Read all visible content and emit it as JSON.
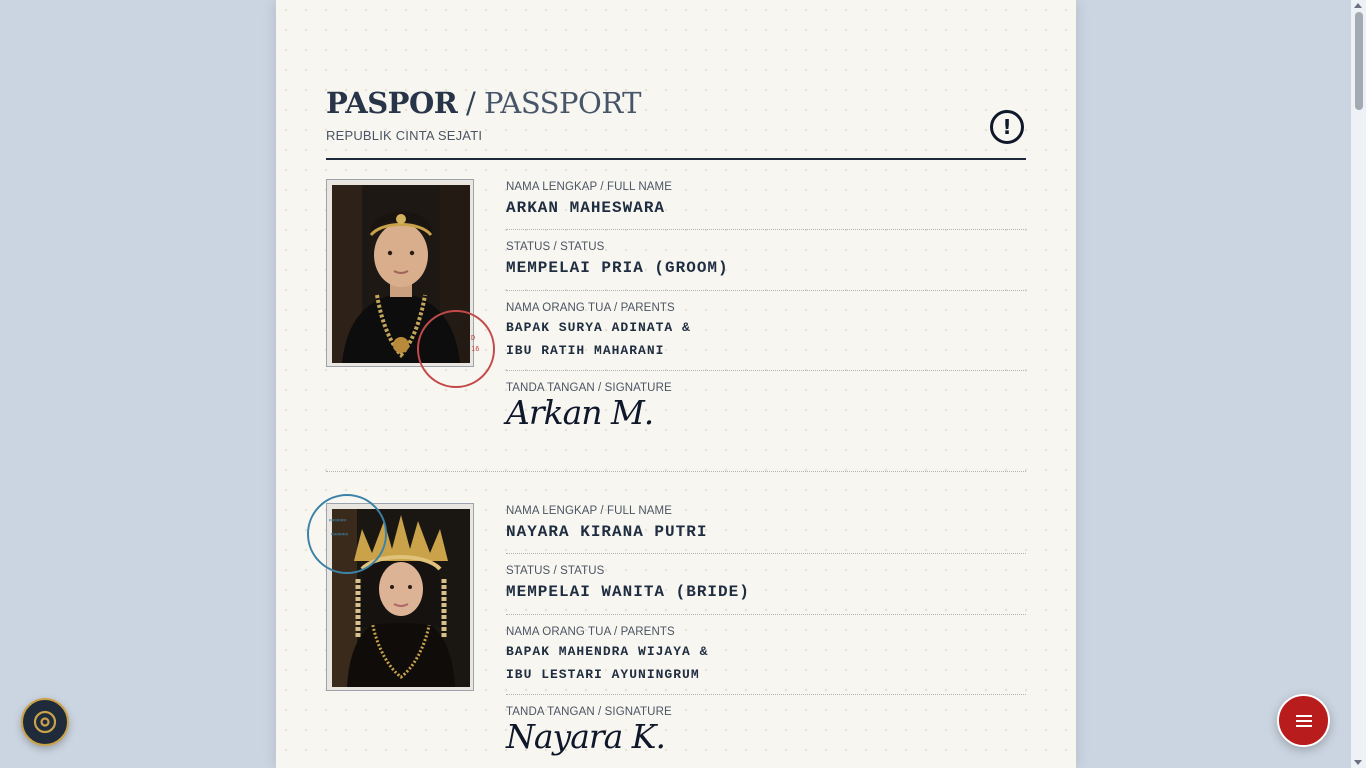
{
  "header": {
    "title_bold": "PASPOR",
    "title_sep": " / ",
    "title_light": "PASSPORT",
    "subtitle": "REPUBLIK CINTA SEJATI",
    "alert_icon": "exclamation-circle-icon"
  },
  "entries": [
    {
      "name_label": "NAMA LENGKAP / FULL NAME",
      "name": "ARKAN MAHESWARA",
      "status_label": "STATUS / STATUS",
      "status": "MEMPELAI PRIA (GROOM)",
      "parents_label": "NAMA ORANG TUA / PARENTS",
      "parents_line1": "BAPAK SURYA ADINATA &",
      "parents_line2": "IBU RATIH MAHARANI",
      "signature_label": "TANDA TANGAN / SIGNATURE",
      "signature": "Arkan M."
    },
    {
      "name_label": "NAMA LENGKAP / FULL NAME",
      "name": "NAYARA KIRANA PUTRI",
      "status_label": "STATUS / STATUS",
      "status": "MEMPELAI WANITA (BRIDE)",
      "parents_label": "NAMA ORANG TUA / PARENTS",
      "parents_line1": "BAPAK MAHENDRA WIJAYA &",
      "parents_line2": "IBU LESTARI AYUNINGRUM",
      "signature_label": "TANDA TANGAN / SIGNATURE",
      "signature": "Nayara K."
    }
  ],
  "controls": {
    "music_icon": "music-disc-icon",
    "menu_icon": "hamburger-menu-icon"
  },
  "colors": {
    "accent_red": "#b91c1c",
    "stamp_red": "#c44a4a",
    "stamp_blue": "#3b82a6",
    "ink": "#1f2d40",
    "gold": "#c9a24a"
  }
}
